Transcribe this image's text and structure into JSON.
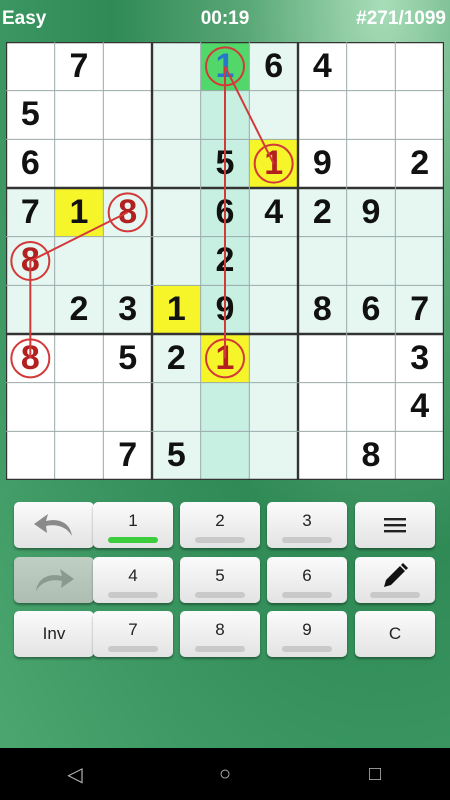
{
  "header": {
    "level": "Easy",
    "timer": "00:19",
    "puzzle": "#271/1099"
  },
  "grid": [
    [
      "",
      "7",
      "",
      "",
      "1",
      "6",
      "4",
      "",
      ""
    ],
    [
      "5",
      "",
      "",
      "",
      "",
      "",
      "",
      "",
      ""
    ],
    [
      "6",
      "",
      "",
      "",
      "5",
      "1",
      "9",
      "",
      "2"
    ],
    [
      "7",
      "1",
      "8",
      "",
      "6",
      "4",
      "2",
      "9",
      ""
    ],
    [
      "8",
      "",
      "",
      "",
      "2",
      "",
      "",
      "",
      ""
    ],
    [
      "",
      "2",
      "3",
      "1",
      "9",
      "",
      "8",
      "6",
      "7"
    ],
    [
      "8",
      "",
      "5",
      "2",
      "1",
      "",
      "",
      "",
      "3"
    ],
    [
      "",
      "",
      "",
      "",
      "",
      "",
      "",
      "",
      "4"
    ],
    [
      "",
      "",
      "7",
      "5",
      "",
      "",
      "",
      "8",
      ""
    ]
  ],
  "keypad": {
    "undo_icon": "undo-arrow-icon",
    "redo_icon": "redo-arrow-icon",
    "menu_icon": "hamburger-menu-icon",
    "pencil_icon": "pencil-icon",
    "digits": [
      "1",
      "2",
      "3",
      "4",
      "5",
      "6",
      "7",
      "8",
      "9"
    ],
    "active_digit": "1",
    "inv_label": "Inv",
    "clear_label": "C"
  },
  "nav": {
    "back": "◁",
    "home": "○",
    "recent": "□"
  },
  "colors": {
    "highlight_yellow": "#f5f52a",
    "selected_green": "#52d86a",
    "note_red": "#b22020",
    "chain_line": "#d23a3a",
    "region_highlight": "#e6f7f1",
    "cross_highlight": "#c7efe2"
  }
}
